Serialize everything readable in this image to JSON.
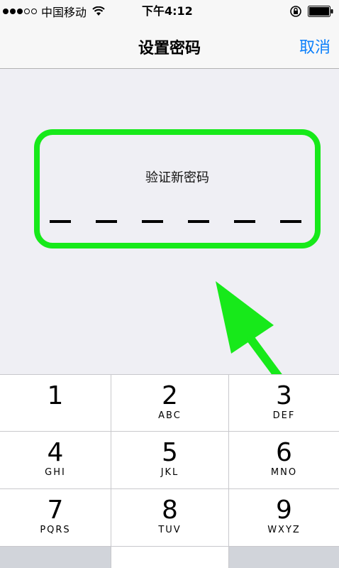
{
  "status_bar": {
    "carrier": "中国移动",
    "time": "下午4:12",
    "signal_icon": "signal-dots-icon",
    "wifi_icon": "wifi-icon",
    "rotation_lock_icon": "rotation-lock-icon",
    "battery_icon": "battery-icon"
  },
  "nav": {
    "title": "设置密码",
    "cancel_label": "取消"
  },
  "passcode": {
    "prompt": "验证新密码",
    "digits_count": 6,
    "highlight_color": "#17e91a"
  },
  "keypad": {
    "keys": [
      {
        "digit": "1",
        "letters": ""
      },
      {
        "digit": "2",
        "letters": "ABC"
      },
      {
        "digit": "3",
        "letters": "DEF"
      },
      {
        "digit": "4",
        "letters": "GHI"
      },
      {
        "digit": "5",
        "letters": "JKL"
      },
      {
        "digit": "6",
        "letters": "MNO"
      },
      {
        "digit": "7",
        "letters": "PQRS"
      },
      {
        "digit": "8",
        "letters": "TUV"
      },
      {
        "digit": "9",
        "letters": "WXYZ"
      }
    ]
  },
  "colors": {
    "accent": "#0a7ffb",
    "annotation": "#17e91a"
  }
}
